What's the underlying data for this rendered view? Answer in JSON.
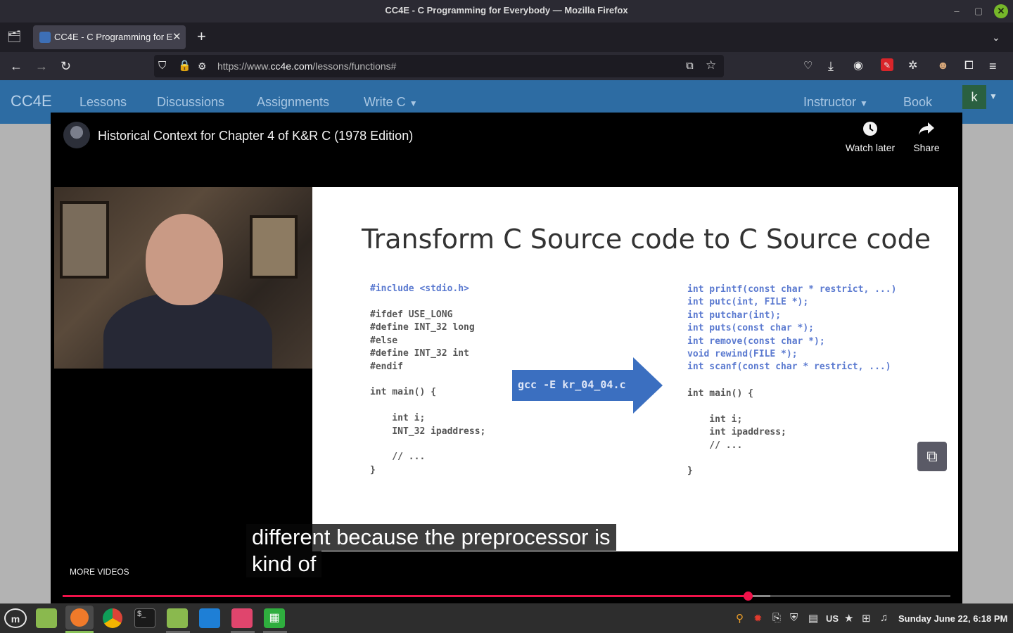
{
  "window": {
    "title": "CC4E - C Programming for Everybody — Mozilla Firefox"
  },
  "browser": {
    "tab_title": "CC4E - C Programming for E",
    "url_prefix": "https://www.",
    "url_domain": "cc4e.com",
    "url_path": "/lessons/functions#"
  },
  "site_nav": {
    "brand": "CC4E",
    "links": [
      "Lessons",
      "Discussions",
      "Assignments",
      "Write C",
      "Instructor",
      "Book"
    ],
    "user_initial": "k"
  },
  "video": {
    "title": "Historical Context for Chapter 4 of K&R C (1978 Edition)",
    "watch_later": "Watch later",
    "share": "Share",
    "more_videos": "MORE VIDEOS",
    "caption_lines": [
      "different because the preprocessor is",
      "kind of"
    ],
    "progress_played_fraction": 0.772,
    "progress_buffered_fraction": 0.797
  },
  "slide": {
    "heading": "Transform C Source code to C Source code",
    "left_include": "#include <stdio.h>",
    "left_code": "#ifdef USE_LONG\n#define INT_32 long\n#else\n#define INT_32 int\n#endif\n\nint main() {\n\n    int i;\n    INT_32 ipaddress;\n\n    // ...\n}",
    "arrow_label": "gcc -E kr_04_04.c",
    "right_decls": "int printf(const char * restrict, ...)\nint putc(int, FILE *);\nint putchar(int);\nint puts(const char *);\nint remove(const char *);\nvoid rewind(FILE *);\nint scanf(const char * restrict, ...)",
    "right_code": "int main() {\n\n    int i;\n    int ipaddress;\n    // ...\n\n}"
  },
  "taskbar": {
    "keyboard_layout": "US",
    "clock": "Sunday June 22, 6:18 PM"
  },
  "colors": {
    "site_nav_bg": "#2d6ca3",
    "progress": "#f0124a",
    "arrow": "#3b6fc0"
  }
}
